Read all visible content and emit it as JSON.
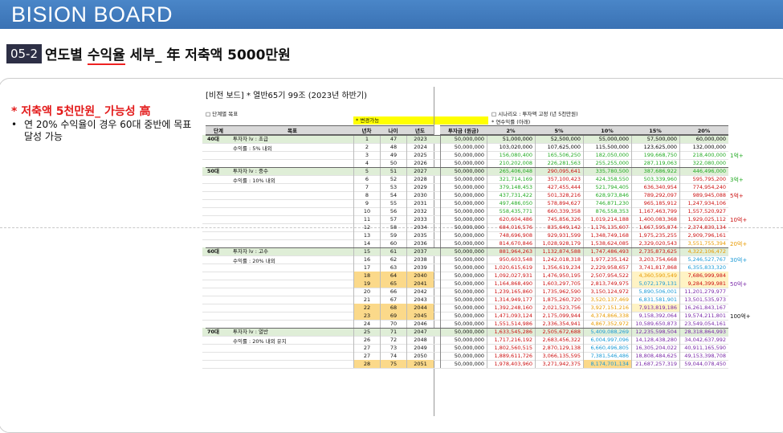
{
  "brand": "BISION BOARD",
  "page": {
    "badge": "05-2",
    "title_a": "연도별 ",
    "title_b": "수익율",
    "title_c": " 세부_ 年 저축액 ",
    "title_d": "5000만원"
  },
  "left": {
    "heading": "* 저축액 5천만원_ 가능성 高",
    "bullet": "•",
    "note": "연 20% 수익율이 경우 60대 중반에 목표달성 가능"
  },
  "sheet": {
    "title": "[비전 보드]   * 열반65기 99조 (2023년 하반기)",
    "sec_left": "□ 단계별 목표",
    "sec_right": "□ 시나리오 : 투자액 고정 (년 5천만원)",
    "sub_right": "* 연수익률 (아래)",
    "change": "* 변경가능",
    "headers": [
      "단계",
      "목표",
      "년차",
      "나이",
      "년도",
      "투자금 (원금)",
      "2%",
      "5%",
      "10%",
      "15%",
      "20%"
    ],
    "stages": [
      {
        "label": "40대",
        "g1": "투자자 lv : 초급",
        "g2": "수익률 : 5% 내외"
      },
      {
        "label": "50대",
        "g1": "투자자 lv : 중수",
        "g2": "수익률 : 10% 내외"
      },
      {
        "label": "60대",
        "g1": "투자자 lv : 고수",
        "g2": "수익률 : 20% 내외"
      },
      {
        "label": "70대",
        "g1": "투자자 lv : 열반",
        "g2": "수익률 : 20% 내외 유지"
      }
    ],
    "rows": [
      [
        "1",
        "47",
        "2023",
        "50,000,000",
        "51,000,000",
        "52,500,000",
        "55,000,000",
        "57,500,000",
        "60,000,000"
      ],
      [
        "2",
        "48",
        "2024",
        "50,000,000",
        "103,020,000",
        "107,625,000",
        "115,500,000",
        "123,625,000",
        "132,000,000"
      ],
      [
        "3",
        "49",
        "2025",
        "50,000,000",
        "156,080,400",
        "165,506,250",
        "182,050,000",
        "199,668,750",
        "218,400,000"
      ],
      [
        "4",
        "50",
        "2026",
        "50,000,000",
        "210,202,008",
        "226,281,563",
        "255,255,000",
        "287,119,063",
        "322,080,000"
      ],
      [
        "5",
        "51",
        "2027",
        "50,000,000",
        "265,406,048",
        "290,095,641",
        "335,780,500",
        "387,686,922",
        "446,496,000"
      ],
      [
        "6",
        "52",
        "2028",
        "50,000,000",
        "321,714,169",
        "357,100,423",
        "424,358,550",
        "503,339,960",
        "595,795,200"
      ],
      [
        "7",
        "53",
        "2029",
        "50,000,000",
        "379,148,453",
        "427,455,444",
        "521,794,405",
        "636,340,954",
        "774,954,240"
      ],
      [
        "8",
        "54",
        "2030",
        "50,000,000",
        "437,731,422",
        "501,328,216",
        "628,973,846",
        "789,292,097",
        "989,945,088"
      ],
      [
        "9",
        "55",
        "2031",
        "50,000,000",
        "497,486,050",
        "578,894,627",
        "746,871,230",
        "965,185,912",
        "1,247,934,106"
      ],
      [
        "10",
        "56",
        "2032",
        "50,000,000",
        "558,435,771",
        "660,339,358",
        "876,558,353",
        "1,167,463,799",
        "1,557,520,927"
      ],
      [
        "11",
        "57",
        "2033",
        "50,000,000",
        "620,604,486",
        "745,856,326",
        "1,019,214,188",
        "1,400,083,368",
        "1,929,025,112"
      ],
      [
        "12",
        "58",
        "2034",
        "50,000,000",
        "684,016,576",
        "835,649,142",
        "1,176,135,607",
        "1,667,595,874",
        "2,374,830,134"
      ],
      [
        "13",
        "59",
        "2035",
        "50,000,000",
        "748,696,908",
        "929,931,599",
        "1,348,749,168",
        "1,975,235,255",
        "2,909,796,161"
      ],
      [
        "14",
        "60",
        "2036",
        "50,000,000",
        "814,670,846",
        "1,028,928,179",
        "1,538,624,085",
        "2,329,020,543",
        "3,551,755,394"
      ],
      [
        "15",
        "61",
        "2037",
        "50,000,000",
        "881,964,263",
        "1,132,874,588",
        "1,747,486,493",
        "2,735,873,625",
        "4,322,106,472"
      ],
      [
        "16",
        "62",
        "2038",
        "50,000,000",
        "950,603,548",
        "1,242,018,318",
        "1,977,235,142",
        "3,203,754,668",
        "5,246,527,767"
      ],
      [
        "17",
        "63",
        "2039",
        "50,000,000",
        "1,020,615,619",
        "1,356,619,234",
        "2,229,958,657",
        "3,741,817,868",
        "6,355,833,320"
      ],
      [
        "18",
        "64",
        "2040",
        "50,000,000",
        "1,092,027,931",
        "1,476,950,195",
        "2,507,954,522",
        "4,360,590,549",
        "7,686,999,984"
      ],
      [
        "19",
        "65",
        "2041",
        "50,000,000",
        "1,164,868,490",
        "1,603,297,705",
        "2,813,749,975",
        "5,072,179,131",
        "9,284,399,981"
      ],
      [
        "20",
        "66",
        "2042",
        "50,000,000",
        "1,239,165,860",
        "1,735,962,590",
        "3,150,124,972",
        "5,890,506,001",
        "11,201,279,977"
      ],
      [
        "21",
        "67",
        "2043",
        "50,000,000",
        "1,314,949,177",
        "1,875,260,720",
        "3,520,137,469",
        "6,831,581,901",
        "13,501,535,973"
      ],
      [
        "22",
        "68",
        "2044",
        "50,000,000",
        "1,392,248,160",
        "2,021,523,756",
        "3,927,151,216",
        "7,913,819,186",
        "16,261,843,167"
      ],
      [
        "23",
        "69",
        "2045",
        "50,000,000",
        "1,471,093,124",
        "2,175,099,944",
        "4,374,866,338",
        "9,158,392,064",
        "19,574,211,801"
      ],
      [
        "24",
        "70",
        "2046",
        "50,000,000",
        "1,551,514,986",
        "2,336,354,941",
        "4,867,352,972",
        "10,589,650,873",
        "23,549,054,161"
      ],
      [
        "25",
        "71",
        "2047",
        "50,000,000",
        "1,633,545,286",
        "2,505,672,688",
        "5,409,088,269",
        "12,235,598,504",
        "28,318,864,993"
      ],
      [
        "26",
        "72",
        "2048",
        "50,000,000",
        "1,717,216,192",
        "2,683,456,322",
        "6,004,997,096",
        "14,128,438,280",
        "34,042,637,992"
      ],
      [
        "27",
        "73",
        "2049",
        "50,000,000",
        "1,802,560,515",
        "2,870,129,138",
        "6,660,496,805",
        "16,305,204,022",
        "40,911,165,590"
      ],
      [
        "27",
        "74",
        "2050",
        "50,000,000",
        "1,889,611,726",
        "3,066,135,595",
        "7,381,546,486",
        "18,808,484,625",
        "49,153,398,708"
      ],
      [
        "28",
        "75",
        "2051",
        "50,000,000",
        "1,978,403,960",
        "3,271,942,375",
        "8,174,701,134",
        "21,687,257,319",
        "59,044,078,450"
      ]
    ],
    "markers": [
      {
        "row": 2,
        "text": "1억+",
        "color": "#22aa22"
      },
      {
        "row": 5,
        "text": "3억+",
        "color": "#22aa22"
      },
      {
        "row": 7,
        "text": "5억+",
        "color": "#cc1111"
      },
      {
        "row": 10,
        "text": "10억+",
        "color": "#cc1111"
      },
      {
        "row": 13,
        "text": "20억+",
        "color": "#e89a00"
      },
      {
        "row": 15,
        "text": "30억+",
        "color": "#1a9ad6"
      },
      {
        "row": 18,
        "text": "50억+",
        "color": "#7a2aa8"
      },
      {
        "row": 22,
        "text": "100억+",
        "color": "#111111"
      }
    ]
  }
}
